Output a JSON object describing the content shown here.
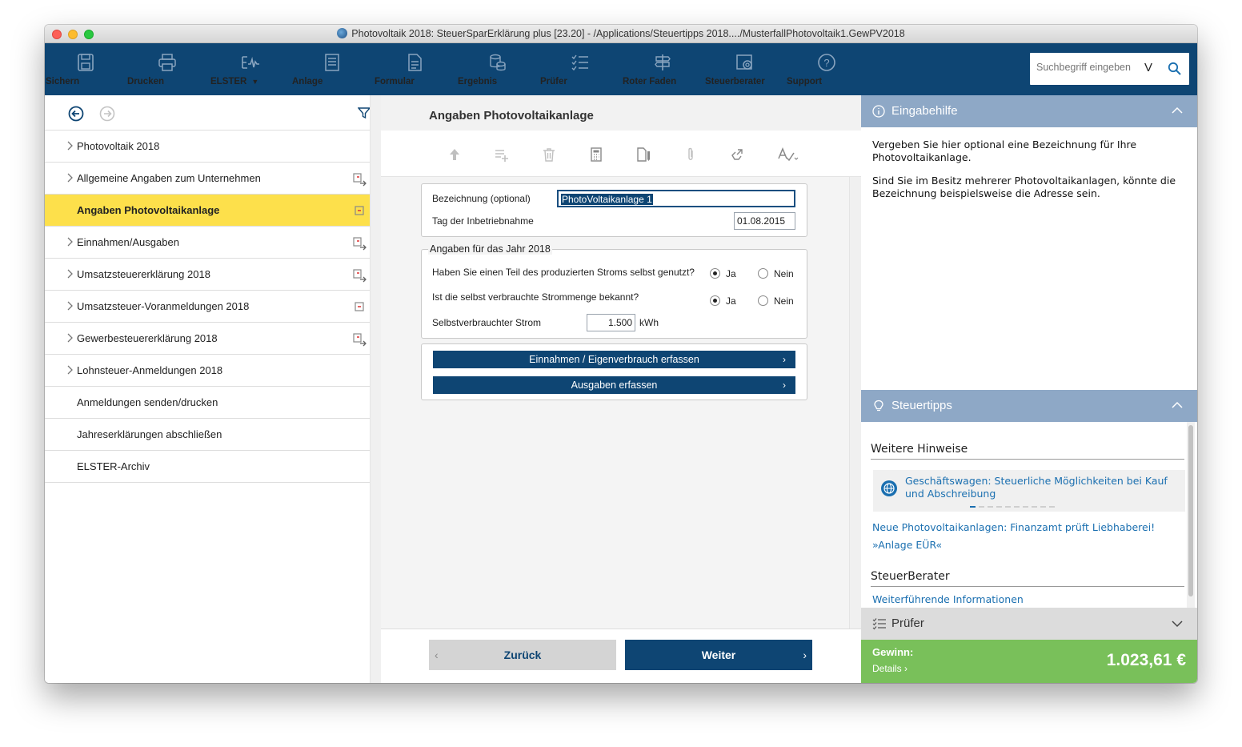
{
  "window": {
    "title": "Photovoltaik 2018: SteuerSparErklärung plus [23.20] - /Applications/Steuertipps 2018..../MusterfallPhotovoltaik1.GewPV2018"
  },
  "toolbar": {
    "buttons": [
      {
        "label": "Sichern",
        "icon": "save-icon"
      },
      {
        "label": "Drucken",
        "icon": "printer-icon"
      },
      {
        "label": "ELSTER",
        "icon": "elster-icon"
      },
      {
        "label": "Anlage",
        "icon": "attachment-form-icon"
      },
      {
        "label": "Formular",
        "icon": "form-icon"
      },
      {
        "label": "Ergebnis",
        "icon": "coins-icon"
      },
      {
        "label": "Prüfer",
        "icon": "checklist-icon"
      },
      {
        "label": "Roter Faden",
        "icon": "signpost-icon"
      },
      {
        "label": "Steuerberater",
        "icon": "advisor-icon"
      },
      {
        "label": "Support",
        "icon": "help-icon"
      }
    ],
    "search": {
      "placeholder": "Suchbegriff eingeben",
      "scope": "V"
    }
  },
  "nav": {
    "items": [
      {
        "label": "Photovoltaik 2018",
        "chevron": true
      },
      {
        "label": "Allgemeine Angaben zum Unternehmen",
        "chevron": true
      },
      {
        "label": "Angaben Photovoltaikanlage",
        "chevron": false,
        "active": true
      },
      {
        "label": "Einnahmen/Ausgaben",
        "chevron": true
      },
      {
        "label": "Umsatzsteuererklärung 2018",
        "chevron": true
      },
      {
        "label": "Umsatzsteuer-Voranmeldungen 2018",
        "chevron": true
      },
      {
        "label": "Gewerbesteuererklärung 2018",
        "chevron": true
      },
      {
        "label": "Lohnsteuer-Anmeldungen 2018",
        "chevron": true
      },
      {
        "label": "Anmeldungen senden/drucken",
        "chevron": false
      },
      {
        "label": "Jahreserklärungen abschließen",
        "chevron": false
      },
      {
        "label": "ELSTER-Archiv",
        "chevron": false
      }
    ]
  },
  "main": {
    "title": "Angaben Photovoltaikanlage",
    "form": {
      "bezeichnung_label": "Bezeichnung (optional)",
      "bezeichnung_value": "PhotoVoltaikanlage 1",
      "inbetrieb_label": "Tag der Inbetriebnahme",
      "inbetrieb_value": "01.08.2015",
      "year_group_legend": "Angaben für das Jahr 2018",
      "q1": "Haben Sie einen Teil des produzierten Stroms selbst genutzt?",
      "q2": "Ist die selbst verbrauchte Strommenge bekannt?",
      "yes": "Ja",
      "no": "Nein",
      "strom_label": "Selbstverbrauchter Strom",
      "strom_value": "1.500",
      "strom_unit": "kWh",
      "btn_einnahmen": "Einnahmen / Eigenverbrauch erfassen",
      "btn_ausgaben": "Ausgaben erfassen"
    },
    "footer": {
      "back": "Zurück",
      "next": "Weiter"
    }
  },
  "right": {
    "help": {
      "title": "Eingabehilfe",
      "p1": "Vergeben Sie hier optional eine Bezeichnung für Ihre Photovoltaikanlage.",
      "p2": "Sind Sie im Besitz mehrerer Photovoltaikanlagen, könnte die Bezeichnung beispielsweise die Adresse sein."
    },
    "tips": {
      "title": "Steuertipps",
      "section1": "Weitere Hinweise",
      "card": "Geschäftswagen: Steuerliche Möglichkeiten bei Kauf und Abschreibung",
      "link1": "Neue Photovoltaikanlagen: Finanzamt prüft Liebhaberei!",
      "link2": "»Anlage EÜR«",
      "section2": "SteuerBerater",
      "link3": "Weiterführende Informationen"
    },
    "pruefer": {
      "title": "Prüfer"
    },
    "gewinn": {
      "label": "Gewinn:",
      "details": "Details",
      "amount": "1.023,61 €"
    }
  },
  "colors": {
    "toolbar": "#0e4573",
    "active_nav": "#fde04b",
    "panel_head": "#8ea8c6",
    "gewinn": "#79c05a",
    "link": "#1a6fb0"
  }
}
